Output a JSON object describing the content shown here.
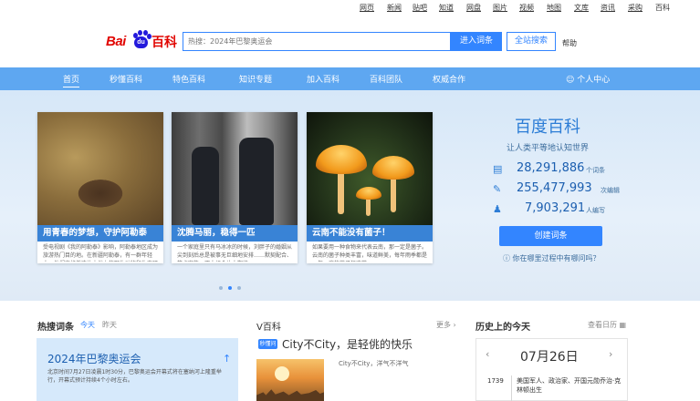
{
  "top_nav": [
    "网页",
    "新闻",
    "贴吧",
    "知道",
    "网盘",
    "图片",
    "视频",
    "地图",
    "文库",
    "资讯",
    "采购",
    "百科"
  ],
  "logo": {
    "text_left": "Bai",
    "text_paw": "du",
    "text_right": "百科"
  },
  "search": {
    "placeholder": "热搜：2024年巴黎奥运会",
    "enter_button": "进入词条",
    "all_button": "全站搜索",
    "help": "帮助"
  },
  "main_nav": {
    "items": [
      "首页",
      "秒懂百科",
      "特色百科",
      "知识专题",
      "加入百科",
      "百科团队",
      "权威合作"
    ],
    "user": "个人中心"
  },
  "slides": [
    {
      "title": "用青春的梦想，守护阿勒泰",
      "desc": "受电视剧《我的阿勒泰》影响，阿勒泰地区成为旅游热门目的地。在新疆阿勒泰，有一群年轻人，他们守护着这片土地上的野生动物和生态环境……"
    },
    {
      "title": "沈腾马丽，稳得一匹",
      "desc": "一个家庭里只有马冰冰的时候，刘胖子的婚姻从尖到刻后总是被事无巨细地安排……默契配合、笑点密集，双人组合让人期待……"
    },
    {
      "title": "云南不能没有菌子！",
      "desc": "如果要用一种食物来代表云南，那一定是菌子。云南的菌子种类丰富，味道鲜美，每年雨季都是一年一度的菌子狂欢节……"
    }
  ],
  "carousel": {
    "count": 3,
    "active": 2
  },
  "stats": {
    "title": "百度百科",
    "subtitle": "让人类平等地认知世界",
    "rows": [
      {
        "icon": "entries-icon",
        "value": "28,291,886",
        "unit": "个词条"
      },
      {
        "icon": "edit-icon",
        "value": "255,477,993",
        "unit": "次编辑"
      },
      {
        "icon": "people-icon",
        "value": "7,903,291",
        "unit": "人编写"
      }
    ],
    "create_button": "创建词条",
    "how_link": "你在哪里过程中有哪问吗？"
  },
  "hot": {
    "title": "热搜词条",
    "tab_today": "今天",
    "tab_yesterday": "昨天",
    "card_title": "2024年巴黎奥运会",
    "card_desc": "北京时间7月27日凌晨1时30分，巴黎奥运会开幕式将在塞纳河上隆重举行，开幕式预计持续4个小时左右。"
  },
  "vbaike": {
    "title": "V百科",
    "more": "更多",
    "tag": "秒懂问",
    "item_title": "City不City，是轻佻的快乐",
    "item_sub": "City不City，洋气不洋气"
  },
  "history": {
    "title": "历史上的今天",
    "view_link": "查看日历",
    "date": "07月26日",
    "year": "1739",
    "event": "美国军人、政治家、开国元勋乔治·克林顿出生"
  },
  "colors": {
    "brand_blue": "#3385ff",
    "nav_blue": "#5ea7f1",
    "logo_red": "#e10602"
  }
}
